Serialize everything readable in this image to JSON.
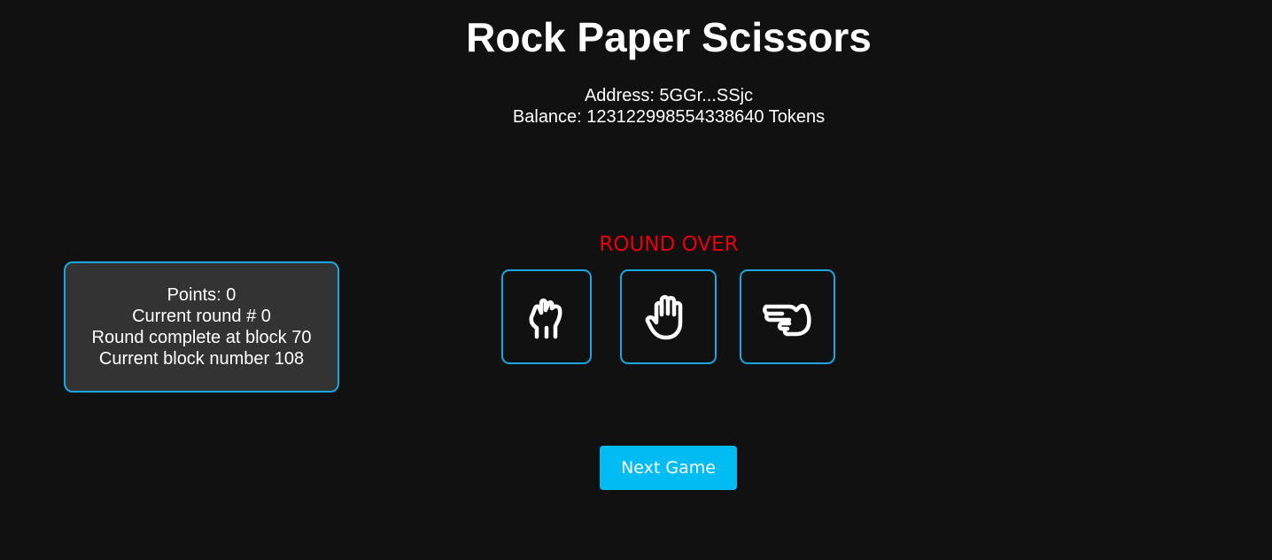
{
  "title": "Rock Paper Scissors",
  "account": {
    "address_label": "Address: 5GGr...SSjc",
    "balance_label": "Balance: 123122998554338640 Tokens"
  },
  "stats": {
    "points": "Points: 0",
    "current_round": "Current round # 0",
    "round_complete": "Round complete at block 70",
    "current_block": "Current block number 108"
  },
  "round_status": "ROUND OVER",
  "moves": [
    {
      "name": "rock",
      "icon": "fist-icon"
    },
    {
      "name": "paper",
      "icon": "open-hand-icon"
    },
    {
      "name": "scissors",
      "icon": "two-fingers-hand-icon"
    }
  ],
  "next_game_label": "Next Game",
  "colors": {
    "background": "#111111",
    "panel": "#333333",
    "accent_border": "#1aa6e0",
    "round_over": "#e8000b",
    "button": "#00bcf2"
  }
}
